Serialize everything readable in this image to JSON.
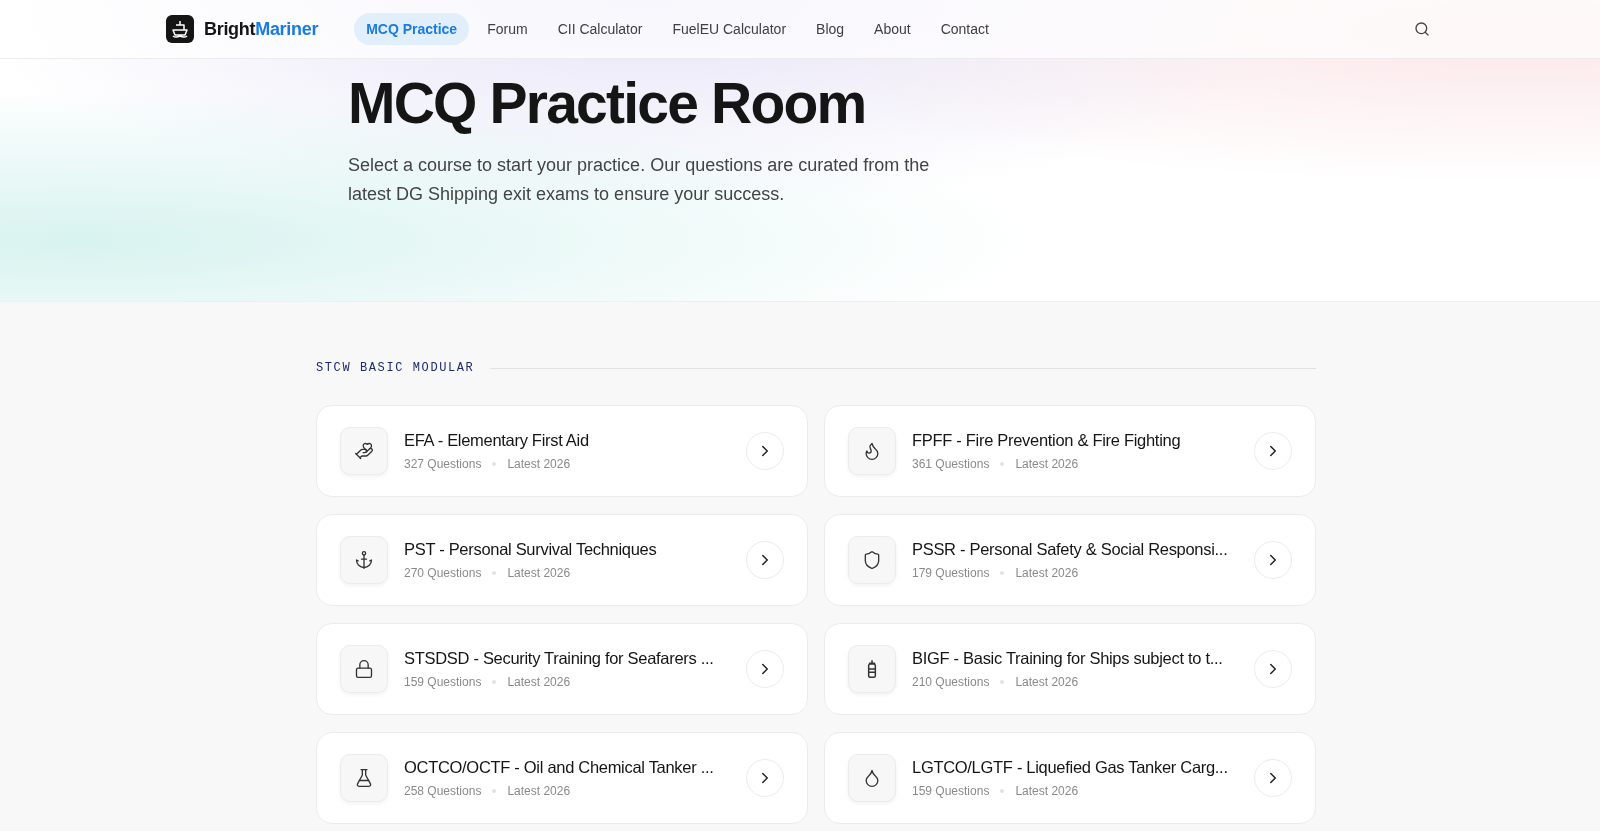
{
  "brand": {
    "part_1": "Bright",
    "part_2": "Mariner"
  },
  "nav": [
    {
      "label": "MCQ Practice",
      "selected": true
    },
    {
      "label": "Forum",
      "selected": false
    },
    {
      "label": "CII Calculator",
      "selected": false
    },
    {
      "label": "FuelEU Calculator",
      "selected": false
    },
    {
      "label": "Blog",
      "selected": false
    },
    {
      "label": "About",
      "selected": false
    },
    {
      "label": "Contact",
      "selected": false
    }
  ],
  "hero": {
    "title": "MCQ Practice Room",
    "subtitle": "Select a course to start your practice. Our questions are curated from the latest DG Shipping exit exams to ensure your success."
  },
  "section": {
    "label": "STCW BASIC MODULAR",
    "courses": [
      {
        "title": "EFA - Elementary First Aid",
        "questions": "327 Questions",
        "edition": "Latest 2026"
      },
      {
        "title": "FPFF - Fire Prevention & Fire Fighting",
        "questions": "361 Questions",
        "edition": "Latest 2026"
      },
      {
        "title": "PST - Personal Survival Techniques",
        "questions": "270 Questions",
        "edition": "Latest 2026"
      },
      {
        "title": "PSSR - Personal Safety & Social Responsi...",
        "questions": "179 Questions",
        "edition": "Latest 2026"
      },
      {
        "title": "STSDSD - Security Training for Seafarers ...",
        "questions": "159 Questions",
        "edition": "Latest 2026"
      },
      {
        "title": "BIGF - Basic Training for Ships subject to t...",
        "questions": "210 Questions",
        "edition": "Latest 2026"
      },
      {
        "title": "OCTCO/OCTF - Oil and Chemical Tanker ...",
        "questions": "258 Questions",
        "edition": "Latest 2026"
      },
      {
        "title": "LGTCO/LGTF - Liquefied Gas Tanker Carg...",
        "questions": "159 Questions",
        "edition": "Latest 2026"
      }
    ]
  }
}
